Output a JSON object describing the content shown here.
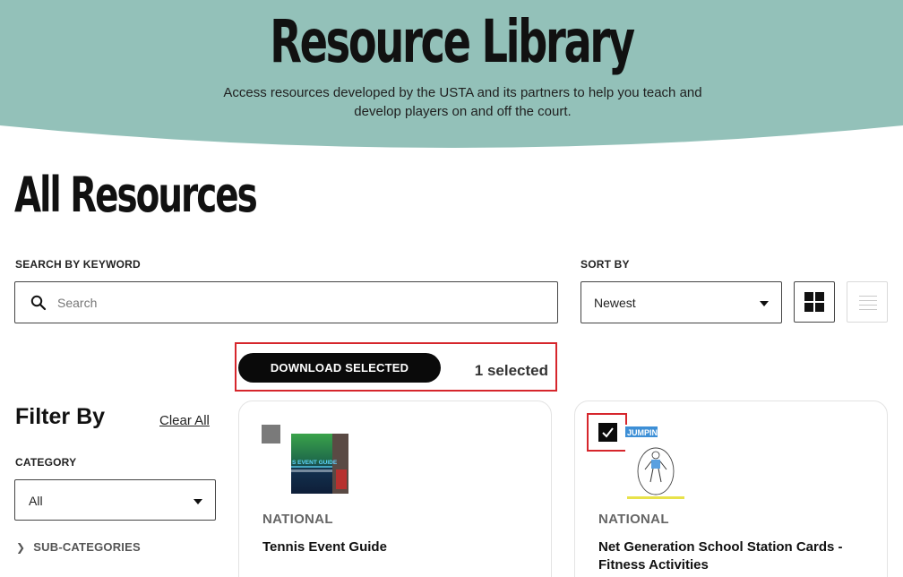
{
  "hero": {
    "title": "Resource Library",
    "subtitle": "Access resources developed by the USTA and its partners to help you teach and develop players on and off the court.",
    "band_color": "#93c1b9"
  },
  "page": {
    "title": "All Resources"
  },
  "search": {
    "label": "SEARCH BY KEYWORD",
    "placeholder": "Search",
    "value": "",
    "icon": "search-icon"
  },
  "sort": {
    "label": "SORT BY",
    "selected": "Newest"
  },
  "view": {
    "grid_icon": "grid-view-icon",
    "list_icon": "list-view-icon",
    "active": "grid"
  },
  "bulk": {
    "download_label": "DOWNLOAD SELECTED",
    "selected_text": "1 selected",
    "highlight_color": "#d6262c"
  },
  "filters": {
    "title": "Filter By",
    "clear_label": "Clear All",
    "category_label": "CATEGORY",
    "category_selected": "All",
    "subcategories_label": "SUB-CATEGORIES"
  },
  "cards": [
    {
      "tag": "NATIONAL",
      "title": "Tennis Event Guide",
      "checked": false,
      "thumb_text": "S EVENT GUIDE"
    },
    {
      "tag": "NATIONAL",
      "title": "Net Generation School Station Cards - Fitness Activities",
      "checked": true,
      "thumb_text": "JUMPING"
    }
  ]
}
